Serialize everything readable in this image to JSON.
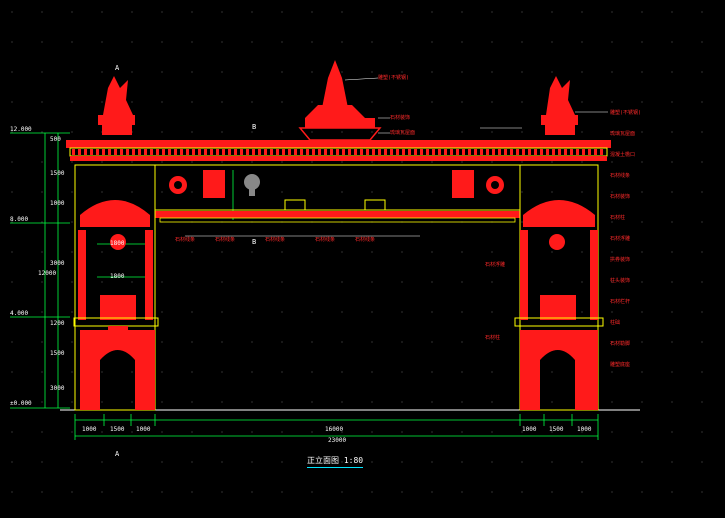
{
  "drawing": {
    "title": "正立面图",
    "scale": "1:80",
    "colors": {
      "background": "#000000",
      "ornament": "#ff1a1a",
      "outline": "#ffff00",
      "dimension": "#00ff40",
      "text": "#ffffff",
      "accent": "#00e5ff"
    },
    "levels": [
      "12.000",
      "8.000",
      "4.000",
      "±0.000"
    ],
    "section_marks": [
      "A",
      "B",
      "B",
      "A"
    ],
    "bottom_dims_row1": [
      "1000",
      "1500",
      "1000",
      "16000",
      "1000",
      "1500",
      "1000"
    ],
    "bottom_dims_total": "23000",
    "left_dims": [
      "500",
      "1500",
      "1000",
      "3000",
      "1200",
      "1500",
      "3000",
      "12000"
    ],
    "inner_dims": [
      "1800",
      "1800"
    ],
    "callouts_right": [
      "雕塑(不锈钢)",
      "琉璃瓦屋面",
      "混凝土檐口",
      "石材线条",
      "石材装饰",
      "石材柱",
      "石材浮雕",
      "拱券装饰",
      "柱头装饰",
      "石材栏杆",
      "柱础",
      "石材勒脚",
      "雕塑底座"
    ],
    "callouts_top": [
      "雕塑(不锈钢)",
      "石材装饰",
      "琉璃瓦屋面"
    ],
    "callouts_mid": [
      "石材线条",
      "石材线条",
      "石材线条",
      "石材线条",
      "石材线条"
    ],
    "callouts_left": [
      "石材浮雕",
      "石材柱"
    ]
  }
}
